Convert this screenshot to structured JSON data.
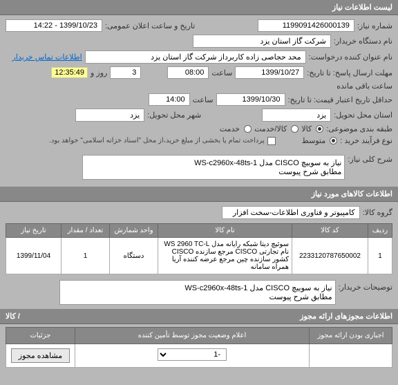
{
  "sections": {
    "listing": "لیست اطلاعات نیاز"
  },
  "labels": {
    "need_no": "شماره نیاز:",
    "announce_time": "تاریخ و ساعت اعلان عمومی:",
    "buyer_device": "نام دستگاه خریدار:",
    "requester": "نام عنوان کننده درخواست:",
    "buyer_contact": "اطلاعات تماس خریدار",
    "deadline": "مهلت ارسال پاسخ: تا تاریخ:",
    "hour": "ساعت",
    "day": "روز و",
    "remaining": "ساعت باقی مانده",
    "credit_from": "حداقل تاریخ اعتبار قیمت: تا تاریخ:",
    "delivery_province": "استان محل تحویل:",
    "delivery_city": "شهر محل تحویل:",
    "grouping": "طبقه بندی موضوعی:",
    "goods": "کالا",
    "service": "کالا/خدمت",
    "service2": "خدمت",
    "process_type": "نوع فرآیند خرید :",
    "medium": "متوسط",
    "partial_note": "پرداخت تمام یا بخشی از مبلغ خرید،از محل \"اسناد خزانه اسلامی\" خواهد بود.",
    "general_desc": "شرح کلی نیاز:",
    "goods_info": "اطلاعات کالاهای مورد نیاز",
    "goods_group": "گروه کالا:",
    "buyer_notes": "توضیحات خریدار:",
    "attachments": "اطلاعات مجوزهای ارائه مجوز",
    "by_goods": "/ کالا",
    "mandatory": "اجباری بودن ارائه مجوز",
    "status_announce": "اعلام وضعیت مجوز توسط تأمین کننده",
    "details": "جزئیات",
    "view_permit": "مشاهده مجوز"
  },
  "fields": {
    "need_no": "1199091426000139",
    "announce": "1399/10/23 - 14:22",
    "buyer_device": "شرکت گاز استان یزد",
    "requester": "محد حجاصی زاده کاربرداز شرکت گاز استان یزد",
    "deadline_date": "1399/10/27",
    "deadline_hour": "08:00",
    "deadline_days": "3",
    "deadline_remaintime": "12:35:49",
    "credit_date": "1399/10/30",
    "credit_hour": "14:00",
    "province": "یزد",
    "city": "یزد",
    "group": "کامپیوتر و فناوری اطلاعات-سخت افزار"
  },
  "desc_text": "نیاز به سوییچ CISCO مدل WS-c2960x-48ts-1\nمطابق شرح پیوست",
  "table": {
    "headers": {
      "idx": "ردیف",
      "code": "کد کالا",
      "name": "نام کالا",
      "unit": "واحد شمارش",
      "qty": "تعداد / مقدار",
      "date": "تاریخ نیاز"
    },
    "rows": [
      {
        "idx": "1",
        "code": "2233120787650002",
        "name": "سوئیچ دیتا شبکه رایانه مدل WS 2960 TC-L نام تجارتی CISCO مرجع سازنده CISCO کشور سازنده چین مرجع عرضه کننده آریا همراه سامانه",
        "unit": "دستگاه",
        "qty": "1",
        "date": "1399/11/04"
      }
    ]
  },
  "buyer_notes": "نیاز به سوییچ CISCO مدل WS-c2960x-48ts-1\nمطابق شرح پیوست",
  "bottom": {
    "status_select": "-1",
    "view_permit_btn": "مشاهده مجوز"
  }
}
